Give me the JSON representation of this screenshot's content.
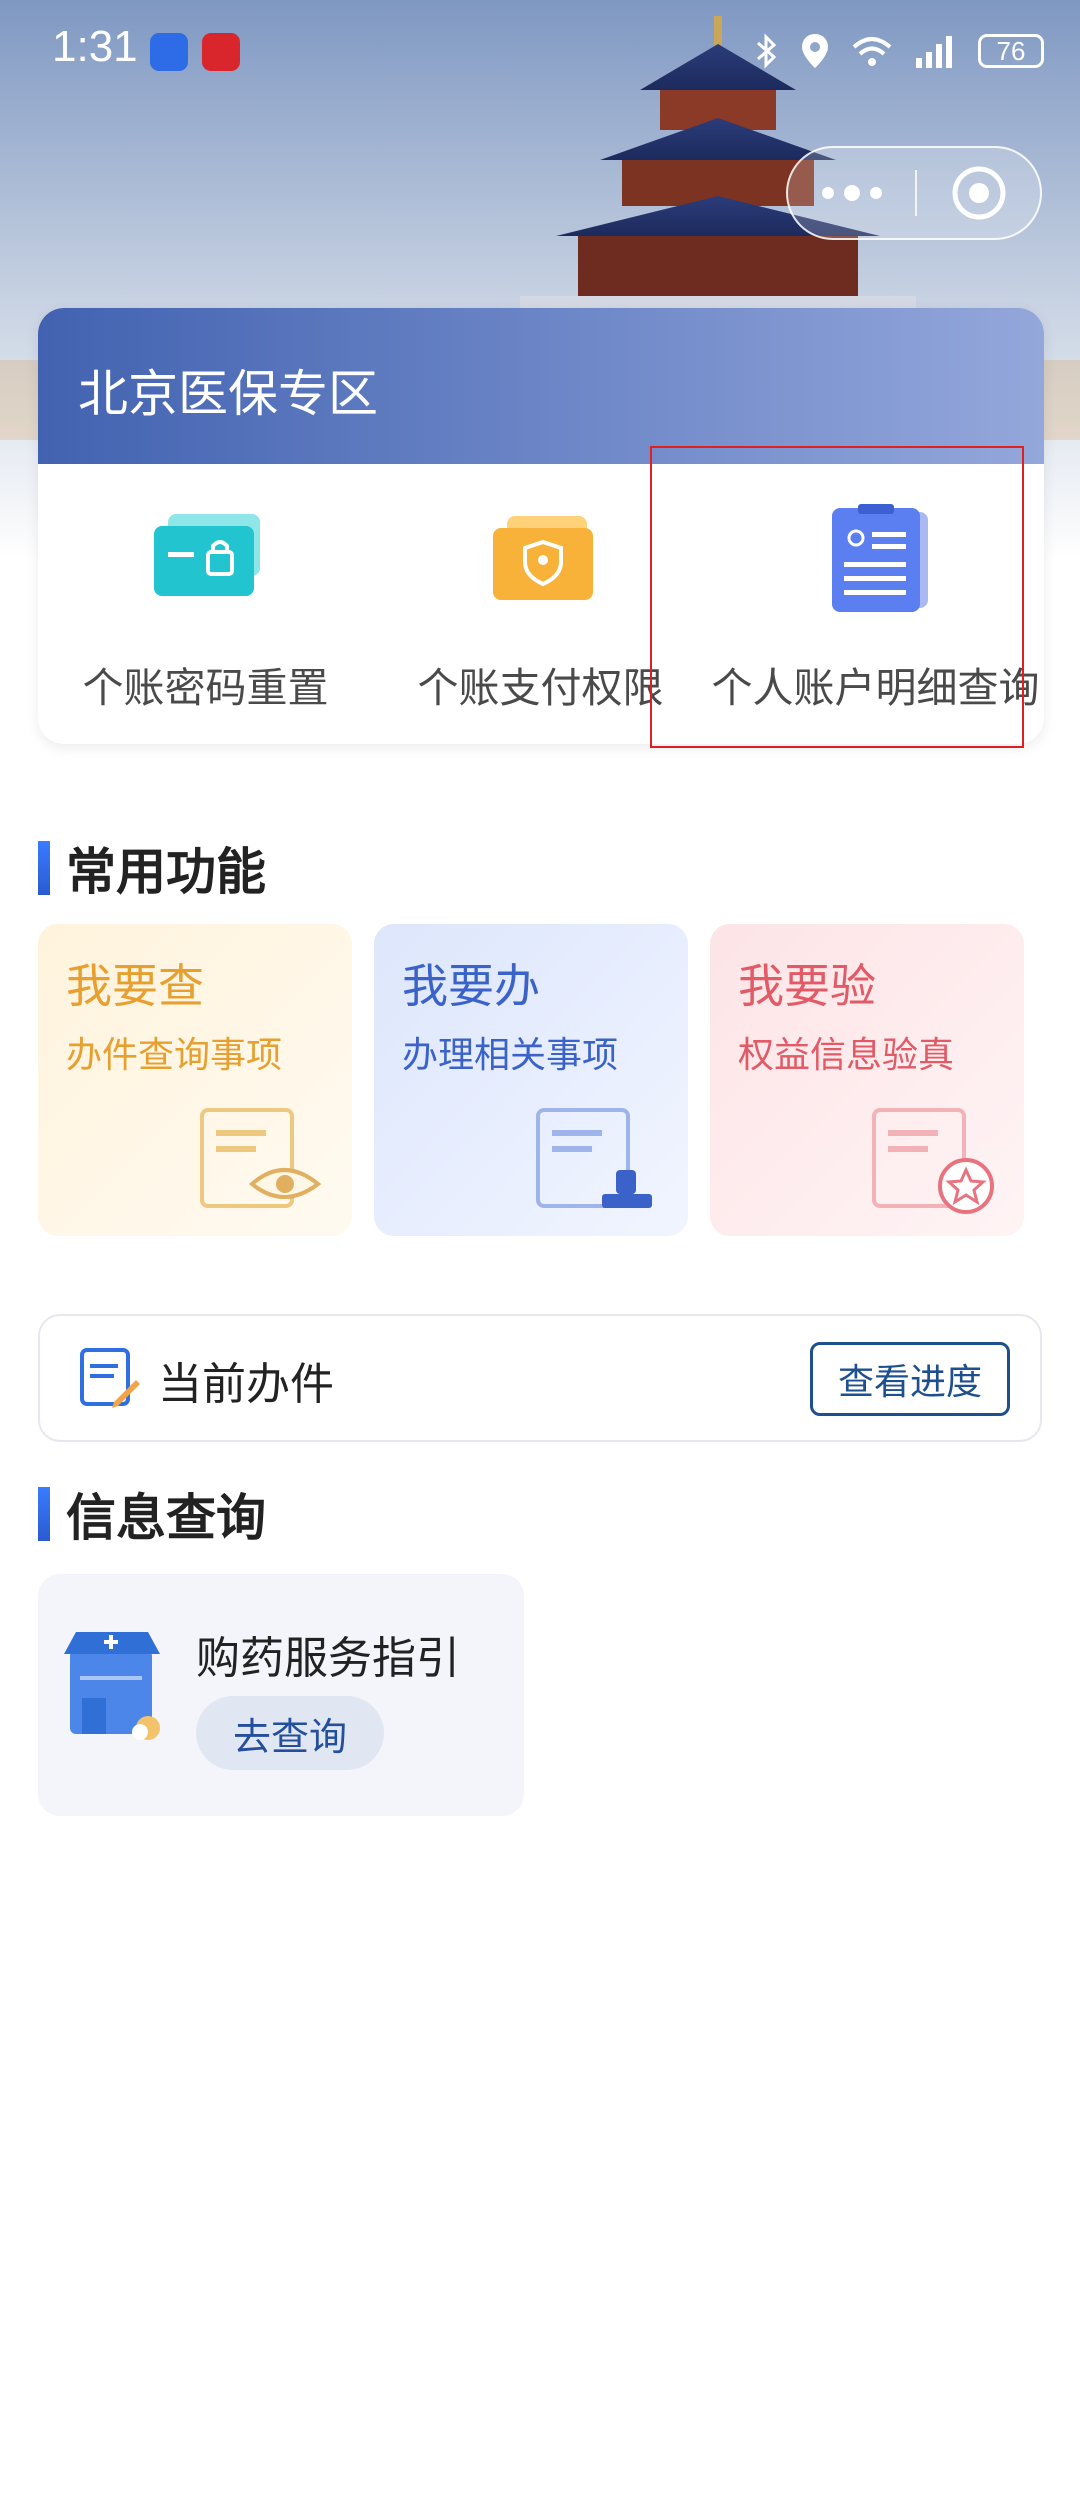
{
  "status_bar": {
    "time": "1:31",
    "battery": "76"
  },
  "zone": {
    "title": "北京医保专区",
    "items": [
      {
        "label": "个账密码重置",
        "icon": "card-lock-icon"
      },
      {
        "label": "个账支付权限",
        "icon": "shield-card-icon"
      },
      {
        "label": "个人账户明细查询",
        "icon": "clipboard-list-icon"
      }
    ]
  },
  "common_functions": {
    "title": "常用功能",
    "cards": [
      {
        "title": "我要查",
        "subtitle": "办件查询事项",
        "icon": "document-eye-icon"
      },
      {
        "title": "我要办",
        "subtitle": "办理相关事项",
        "icon": "document-stamp-icon"
      },
      {
        "title": "我要验",
        "subtitle": "权益信息验真",
        "icon": "document-star-icon"
      }
    ]
  },
  "current_task": {
    "label": "当前办件",
    "button": "查看进度"
  },
  "info_query": {
    "title": "信息查询",
    "card": {
      "label": "购药服务指引",
      "button": "去查询"
    }
  },
  "colors": {
    "accent": "#1e4f8f",
    "highlight": "#e02020",
    "yellow": "#e7a030",
    "blue": "#3a62c9",
    "red": "#e25a66"
  }
}
